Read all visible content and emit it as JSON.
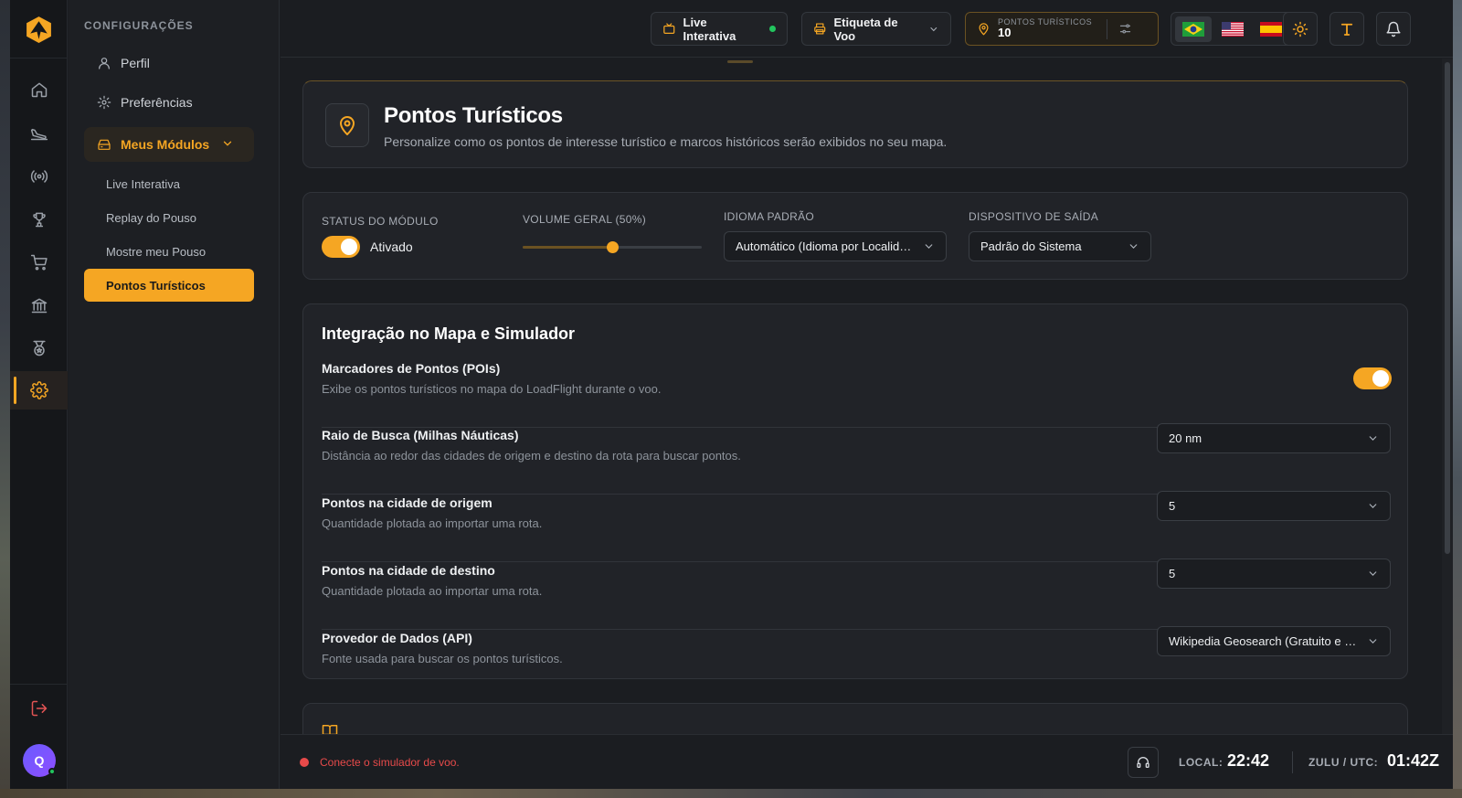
{
  "sidebar": {
    "section_title": "CONFIGURAÇÕES",
    "items": [
      {
        "label": "Perfil",
        "icon": "user-icon"
      },
      {
        "label": "Preferências",
        "icon": "gear-icon"
      },
      {
        "label": "Meus Módulos",
        "icon": "modules-icon"
      }
    ],
    "sub_items": [
      {
        "label": "Live Interativa"
      },
      {
        "label": "Replay do Pouso"
      },
      {
        "label": "Mostre meu Pouso"
      },
      {
        "label": "Pontos Turísticos"
      }
    ]
  },
  "rail": {
    "icons": [
      "home-icon",
      "plane-landing-icon",
      "broadcast-icon",
      "trophy-icon",
      "cart-icon",
      "bank-icon",
      "medal-icon",
      "gear-icon"
    ],
    "logout_icon": "logout-icon",
    "avatar_initial": "Q"
  },
  "topbar": {
    "live_label": "Live Interativa",
    "tag_label": "Etiqueta de Voo",
    "poi_caption": "PONTOS TURÍSTICOS",
    "poi_count": "10",
    "flags": [
      "brazil-flag-icon",
      "usa-flag-icon",
      "spain-flag-icon"
    ]
  },
  "hero": {
    "title": "Pontos Turísticos",
    "subtitle": "Personalize como os pontos de interesse turístico e marcos históricos serão exibidos no seu mapa."
  },
  "status": {
    "module_status_label": "STATUS DO MÓDULO",
    "module_status_value": "Ativado",
    "volume_label": "VOLUME GERAL (50%)",
    "volume_fraction": 0.5,
    "language_label": "IDIOMA PADRÃO",
    "language_value": "Automático (Idioma por Localidade)",
    "device_label": "DISPOSITIVO DE SAÍDA",
    "device_value": "Padrão do Sistema"
  },
  "integration": {
    "title": "Integração no Mapa e Simulador",
    "markers_title": "Marcadores de Pontos (POIs)",
    "markers_desc": "Exibe os pontos turísticos no mapa do LoadFlight durante o voo.",
    "radius_title": "Raio de Busca (Milhas Náuticas)",
    "radius_desc": "Distância ao redor das cidades de origem e destino da rota para buscar pontos.",
    "radius_value": "20 nm",
    "origin_title": "Pontos na cidade de origem",
    "origin_desc": "Quantidade plotada ao importar uma rota.",
    "origin_value": "5",
    "dest_title": "Pontos na cidade de destino",
    "dest_desc": "Quantidade plotada ao importar uma rota.",
    "dest_value": "5",
    "provider_title": "Provedor de Dados (API)",
    "provider_desc": "Fonte usada para buscar os pontos turísticos.",
    "provider_value": "Wikipedia Geosearch (Gratuito e Ilimitado)"
  },
  "footer": {
    "warning": "Conecte o simulador de voo.",
    "local_label": "LOCAL:",
    "local_time": "22:42",
    "zulu_label": "ZULU / UTC:",
    "zulu_time": "01:42Z"
  },
  "colors": {
    "accent": "#f5a623",
    "danger": "#e84a4a",
    "online": "#22c55e"
  }
}
